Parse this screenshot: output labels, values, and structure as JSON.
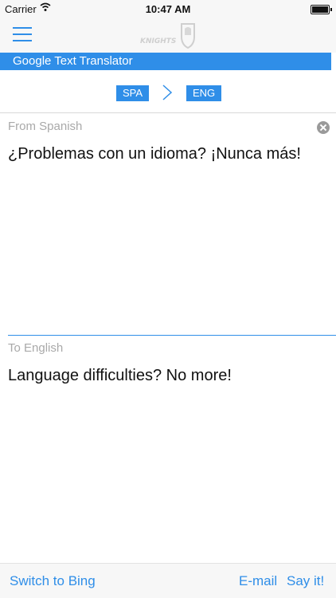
{
  "status_bar": {
    "carrier": "Carrier",
    "time": "10:47 AM"
  },
  "nav": {
    "logo_icon": "knights-shield-logo",
    "menu_icon": "hamburger-menu-icon"
  },
  "title": "Google Text Translator",
  "languages": {
    "source": "SPA",
    "target": "ENG"
  },
  "input": {
    "label": "From Spanish",
    "text": "¿Problemas con un idioma? ¡Nunca más!"
  },
  "output": {
    "label": "To English",
    "text": "Language difficulties? No more!"
  },
  "bottom": {
    "switch_label": "Switch to Bing",
    "email_label": "E-mail",
    "say_label": "Say it!"
  },
  "colors": {
    "accent": "#2f8ee8",
    "placeholder": "#a9a9a9",
    "bar_bg": "#f7f7f7"
  }
}
